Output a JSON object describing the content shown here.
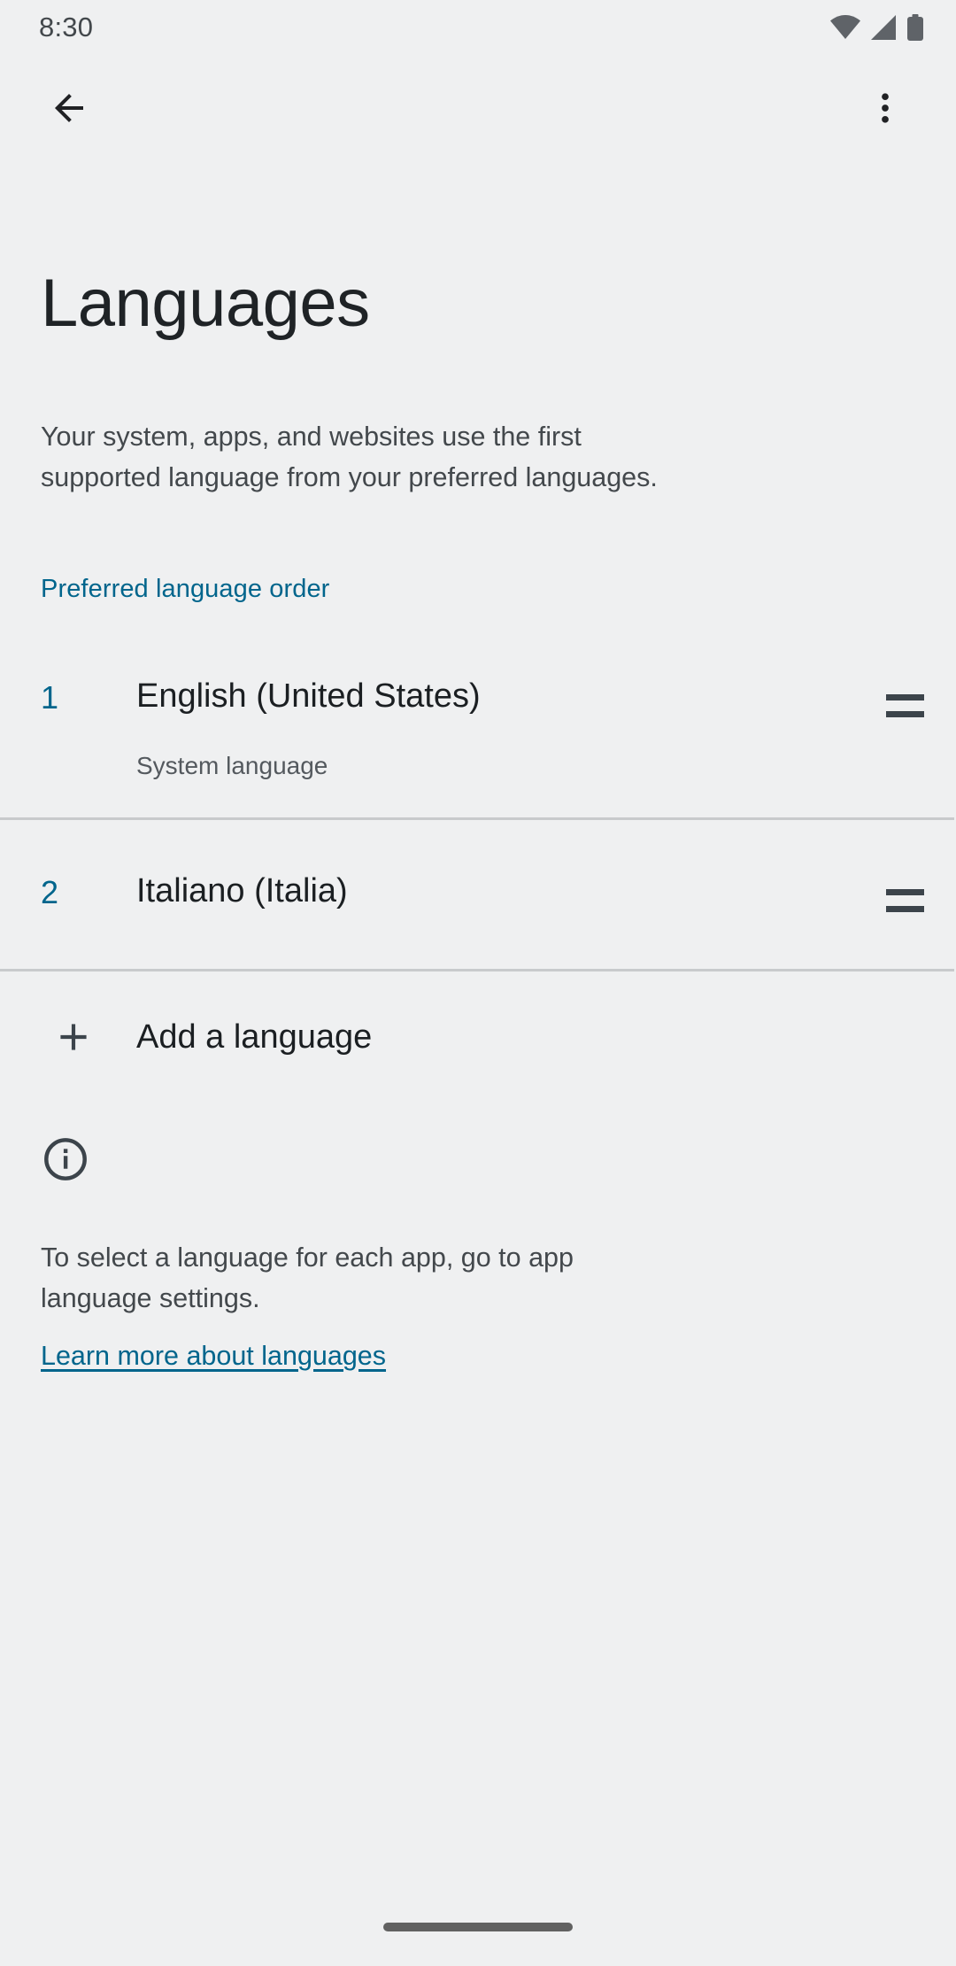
{
  "status_bar": {
    "time": "8:30",
    "icons": [
      "wifi-icon",
      "signal-icon",
      "battery-icon"
    ]
  },
  "toolbar": {
    "back_icon": "back-arrow-icon",
    "overflow_icon": "more-vert-icon"
  },
  "header": {
    "title": "Languages",
    "description": "Your system, apps, and websites use the first supported language from your preferred languages."
  },
  "section": {
    "preferred_order_label": "Preferred language order",
    "accent_color": "#00658c"
  },
  "languages": [
    {
      "index": "1",
      "name": "English (United States)",
      "subtitle": "System language",
      "handle_icon": "drag-handle-icon"
    },
    {
      "index": "2",
      "name": "Italiano (Italia)",
      "subtitle": "",
      "handle_icon": "drag-handle-icon"
    }
  ],
  "add_language": {
    "label": "Add a language",
    "icon": "plus-icon"
  },
  "footer": {
    "icon": "info-icon",
    "text": "To select a language for each app, go to app language settings.",
    "link_label": "Learn more about languages"
  },
  "nav_bar": {
    "handle": "gesture-pill"
  }
}
